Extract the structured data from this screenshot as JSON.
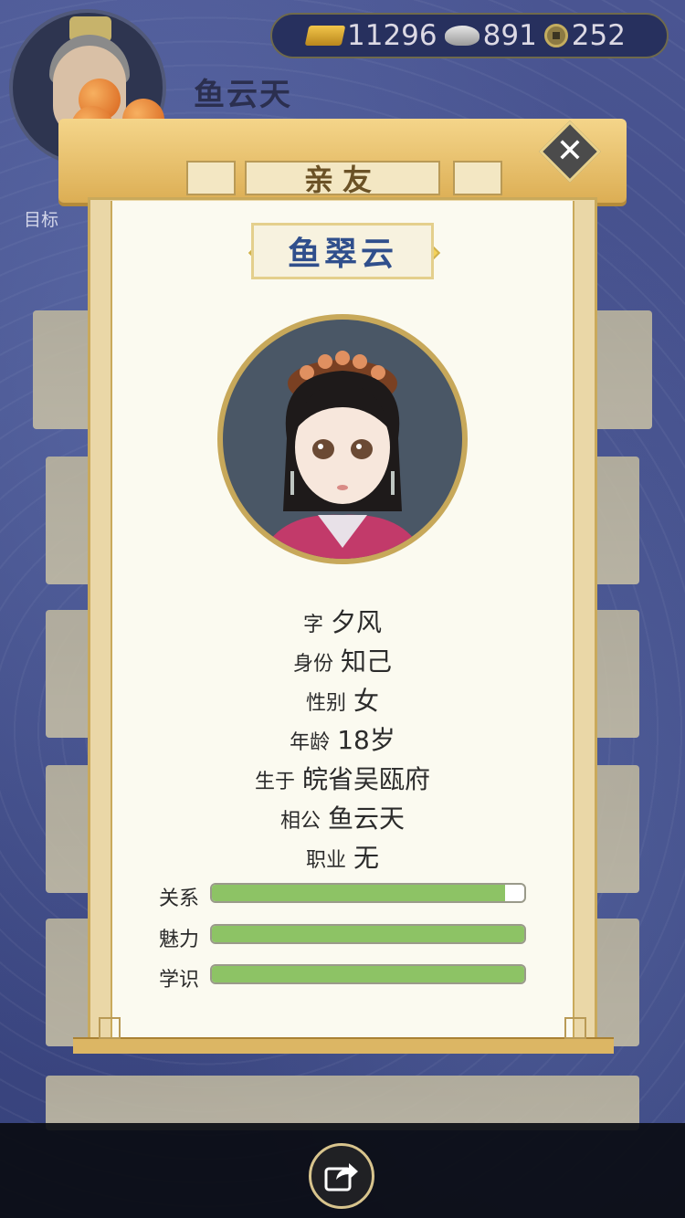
{
  "header": {
    "player_name": "鱼云天",
    "goal_label": "目标",
    "resources": [
      {
        "icon": "gold-ingot-icon",
        "value": "11296"
      },
      {
        "icon": "silver-ingot-icon",
        "value": "891"
      },
      {
        "icon": "copper-coin-icon",
        "value": "252"
      }
    ]
  },
  "dialog": {
    "title": "亲友",
    "close_icon": "close-icon",
    "character_name": "鱼翠云",
    "details": [
      {
        "key": "字",
        "value": "夕风"
      },
      {
        "key": "身份",
        "value": "知己"
      },
      {
        "key": "性别",
        "value": "女"
      },
      {
        "key": "年龄",
        "value": "18岁"
      },
      {
        "key": "生于",
        "value": "皖省吴瓯府"
      },
      {
        "key": "相公",
        "value": "鱼云天"
      },
      {
        "key": "职业",
        "value": "无"
      }
    ],
    "stats": [
      {
        "label": "关系",
        "level": 0.94
      },
      {
        "label": "魅力",
        "level": 1.0
      },
      {
        "label": "学识",
        "level": 1.0
      }
    ]
  },
  "bottom": {
    "share_icon": "share-icon"
  },
  "colors": {
    "bar_fill": "#8dc365",
    "name_text": "#304f8c",
    "title_text": "#6b5226"
  }
}
